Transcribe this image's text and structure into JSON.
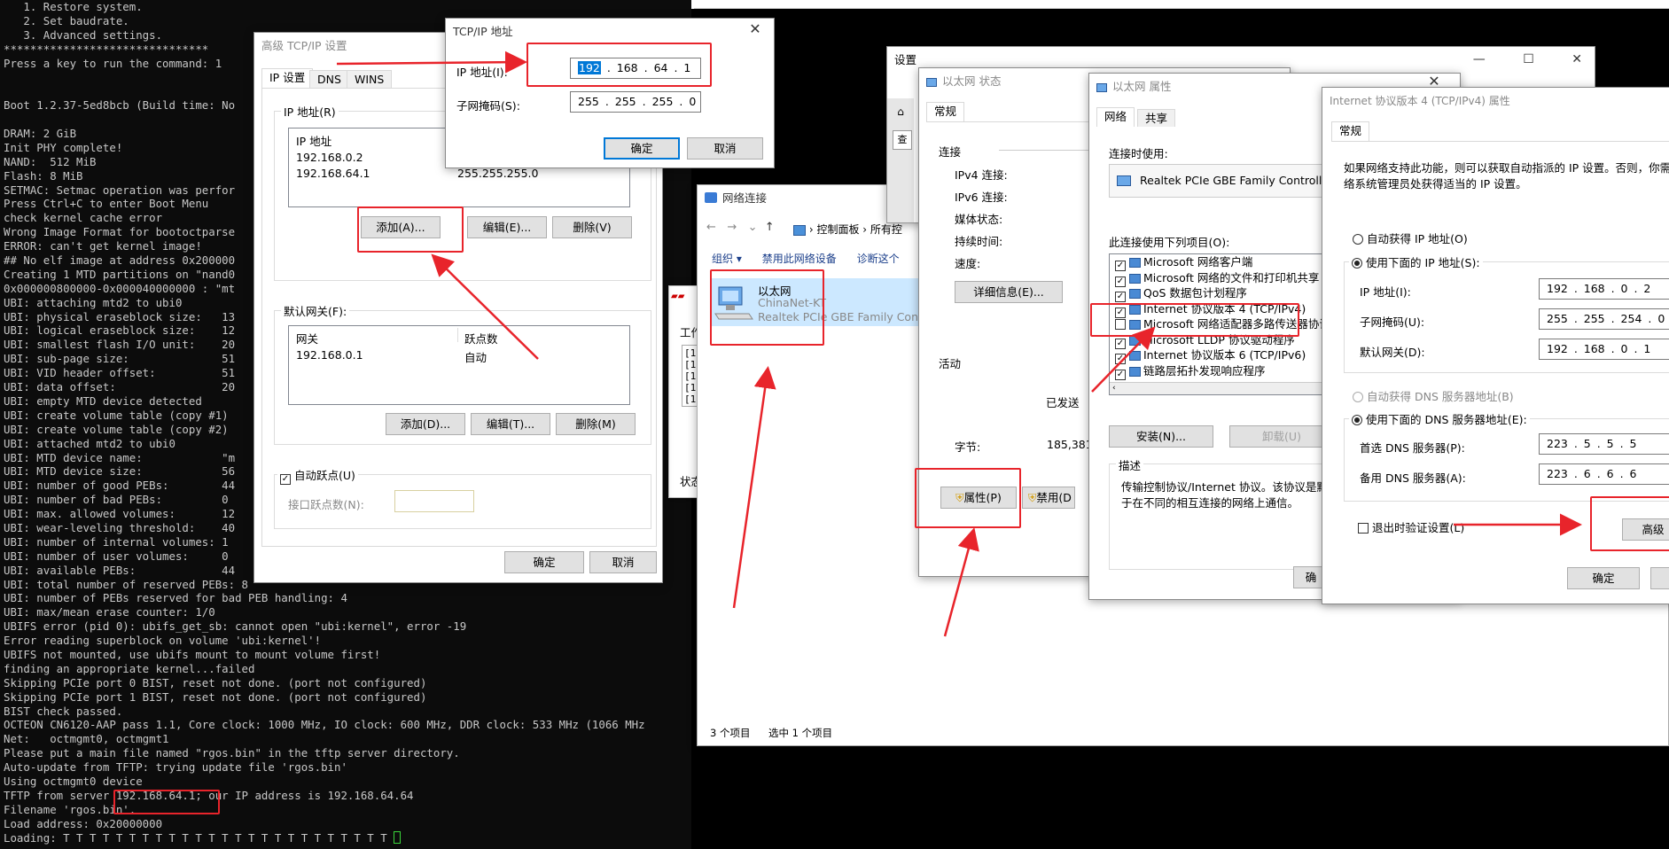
{
  "terminal": {
    "lines": [
      "   1. Restore system.",
      "   2. Set baudrate.",
      "   3. Advanced settings.",
      "*******************************",
      "Press a key to run the command: 1",
      "",
      "",
      "Boot 1.2.37-5ed8bcb (Build time: No",
      "",
      "DRAM: 2 GiB",
      "Init PHY complete!",
      "NAND:  512 MiB",
      "Flash: 8 MiB",
      "SETMAC: Setmac operation was perfor",
      "Press Ctrl+C to enter Boot Menu",
      "check kernel cache error",
      "Wrong Image Format for bootoctparse",
      "ERROR: can't get kernel image!",
      "## No elf image at address 0x200000",
      "Creating 1 MTD partitions on \"nand0",
      "0x000000800000-0x000040000000 : \"mt",
      "UBI: attaching mtd2 to ubi0",
      "UBI: physical eraseblock size:   13",
      "UBI: logical eraseblock size:    12",
      "UBI: smallest flash I/O unit:    20",
      "UBI: sub-page size:              51",
      "UBI: VID header offset:          51",
      "UBI: data offset:                20",
      "UBI: empty MTD device detected",
      "UBI: create volume table (copy #1)",
      "UBI: create volume table (copy #2)",
      "UBI: attached mtd2 to ubi0",
      "UBI: MTD device name:            \"m",
      "UBI: MTD device size:            56",
      "UBI: number of good PEBs:        44",
      "UBI: number of bad PEBs:         0",
      "UBI: max. allowed volumes:       12",
      "UBI: wear-leveling threshold:    40",
      "UBI: number of internal volumes: 1",
      "UBI: number of user volumes:     0",
      "UBI: available PEBs:             44",
      "UBI: total number of reserved PEBs: 8",
      "UBI: number of PEBs reserved for bad PEB handling: 4",
      "UBI: max/mean erase counter: 1/0",
      "UBIFS error (pid 0): ubifs_get_sb: cannot open \"ubi:kernel\", error -19",
      "Error reading superblock on volume 'ubi:kernel'!",
      "UBIFS not mounted, use ubifs mount to mount volume first!",
      "finding an appropriate kernel...failed",
      "Skipping PCIe port 0 BIST, reset not done. (port not configured)",
      "Skipping PCIe port 1 BIST, reset not done. (port not configured)",
      "BIST check passed.",
      "OCTEON CN6120-AAP pass 1.1, Core clock: 1000 MHz, IO clock: 600 MHz, DDR clock: 533 MHz (1066 MHz",
      "Net:   octmgmt0, octmgmt1",
      "Please put a main file named \"rgos.bin\" in the tftp server directory.",
      "Auto-update from TFTP: trying update file 'rgos.bin'",
      "Using octmgmt0 device",
      "TFTP from server 192.168.64.1; our IP address is 192.168.64.64",
      "Filename 'rgos.bin'.",
      "Load address: 0x20000000"
    ],
    "loading": "Loading: T T T T T T T T T T T T T T T T T T T T T T T T T "
  },
  "adv_tcpip": {
    "title": "高级 TCP/IP 设置",
    "tabs": [
      "IP 设置",
      "DNS",
      "WINS"
    ],
    "ip_group": "IP 地址(R)",
    "ip_header": "IP 地址",
    "ip_rows": [
      {
        "ip": "192.168.0.2",
        "mask": ""
      },
      {
        "ip": "192.168.64.1",
        "mask": "255.255.255.0"
      }
    ],
    "add_a": "添加(A)...",
    "edit_e": "编辑(E)...",
    "del_v": "删除(V)",
    "gw_group": "默认网关(F):",
    "gw_header": "网关",
    "metric_header": "跃点数",
    "gw_rows": [
      {
        "gw": "192.168.0.1",
        "metric": "自动"
      }
    ],
    "add_d": "添加(D)...",
    "edit_t": "编辑(T)...",
    "del_m": "删除(M)",
    "auto_metric": "自动跃点(U)",
    "iface_metric": "接口跃点数(N):",
    "ok": "确定",
    "cancel": "取消"
  },
  "tcpip_addr": {
    "title": "TCP/IP 地址",
    "ip_label": "IP 地址(I):",
    "ip_value": [
      "192",
      "168",
      "64",
      "1"
    ],
    "mask_label": "子网掩码(S):",
    "mask_value": [
      "255",
      "255",
      "255",
      "0"
    ],
    "ok": "确定",
    "cancel": "取消"
  },
  "net_conn": {
    "title": "网络连接",
    "path": [
      "控制面板",
      "所有控"
    ],
    "toolbar": [
      "组织 ▾",
      "禁用此网络设备",
      "诊断这个"
    ],
    "adapter_name": "以太网",
    "adapter_net": "ChinaNet-KT",
    "adapter_dev": "Realtek PCIe GBE Family Contr",
    "status_items": "3 个项目",
    "status_selected": "选中 1 个项目"
  },
  "behind": {
    "tab": "工作",
    "status": "状态",
    "rows": [
      "[19",
      "[15",
      "[15",
      "[15",
      "[15"
    ]
  },
  "settings": {
    "title": "设置",
    "search": "查"
  },
  "eth_status": {
    "title": "以太网 状态",
    "tab": "常规",
    "conn": "连接",
    "ipv4": "IPv4 连接:",
    "ipv6": "IPv6 连接:",
    "media": "媒体状态:",
    "duration": "持续时间:",
    "speed": "速度:",
    "details": "详细信息(E)...",
    "activity": "活动",
    "sent": "已发送",
    "bytes": "字节:",
    "bytes_val": "185,381,",
    "props": "属性(P)",
    "disable": "禁用(D"
  },
  "eth_props": {
    "title": "以太网 属性",
    "tabs": [
      "网络",
      "共享"
    ],
    "connect_using": "连接时使用:",
    "adapter": "Realtek PCIe GBE Family Controller",
    "items_label": "此连接使用下列项目(O):",
    "items": [
      {
        "label": "Microsoft 网络客户端",
        "checked": true
      },
      {
        "label": "Microsoft 网络的文件和打印机共享",
        "checked": true
      },
      {
        "label": "QoS 数据包计划程序",
        "checked": true
      },
      {
        "label": "Internet 协议版本 4 (TCP/IPv4)",
        "checked": true
      },
      {
        "label": "Microsoft 网络适配器多路传送器协议",
        "checked": false
      },
      {
        "label": "Microsoft LLDP 协议驱动程序",
        "checked": true
      },
      {
        "label": "Internet 协议版本 6 (TCP/IPv6)",
        "checked": true
      },
      {
        "label": "链路层拓扑发现响应程序",
        "checked": true
      }
    ],
    "install": "安装(N)...",
    "uninstall": "卸载(U)",
    "desc_label": "描述",
    "desc_text": "传输控制协议/Internet 协议。该协议是默认\n于在不同的相互连接的网络上通信。",
    "ok_partial": "确"
  },
  "ipv4_props": {
    "title": "Internet 协议版本 4 (TCP/IPv4) 属性",
    "tab": "常规",
    "intro": "如果网络支持此功能，则可以获取自动指派的 IP 设置。否则，你需要\n络系统管理员处获得适当的 IP 设置。",
    "auto_ip": "自动获得 IP 地址(O)",
    "use_ip": "使用下面的 IP 地址(S):",
    "ip_label": "IP 地址(I):",
    "ip_value": "192 . 168 .  0  .  2",
    "mask_label": "子网掩码(U):",
    "mask_value": "255 . 255 . 254 .  0",
    "gw_label": "默认网关(D):",
    "gw_value": "192 . 168 .  0  .  1",
    "auto_dns": "自动获得 DNS 服务器地址(B)",
    "use_dns": "使用下面的 DNS 服务器地址(E):",
    "dns1_label": "首选 DNS 服务器(P):",
    "dns1_value": "223 .  5  .  5  .  5",
    "dns2_label": "备用 DNS 服务器(A):",
    "dns2_value": "223 .  6  .  6  .  6",
    "validate": "退出时验证设置(L)",
    "advanced": "高级",
    "ok": "确定"
  },
  "colors": {
    "highlight": "#e8242b",
    "selection": "#0078d7",
    "terminal_bg": "#0c0c0c"
  }
}
